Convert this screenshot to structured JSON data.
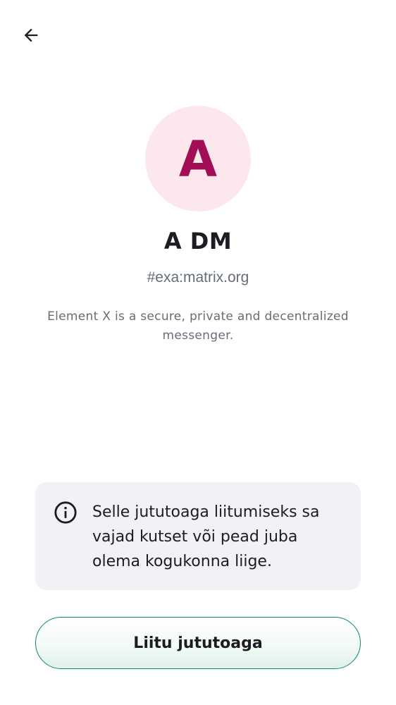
{
  "header": {
    "back_icon": "arrow-left-icon"
  },
  "room": {
    "avatar_letter": "A",
    "avatar_bg_color": "#fce7ec",
    "avatar_letter_color": "#a10e55",
    "name": "A DM",
    "alias": "#exa:matrix.org",
    "topic": "Element X is a secure, private and decentralized messenger."
  },
  "notice": {
    "icon": "info-icon",
    "text": "Selle jututoaga liitumiseks sa vajad kutset või pead juba olema kogukonna liige."
  },
  "actions": {
    "join_label": "Liitu jututoaga",
    "accent_color": "#0b8a63"
  }
}
